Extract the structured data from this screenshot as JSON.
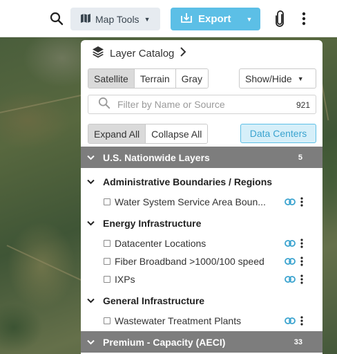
{
  "toolbar": {
    "map_tools_label": "Map Tools",
    "export_label": "Export"
  },
  "catalog": {
    "title": "Layer Catalog",
    "basemaps": [
      {
        "label": "Satellite",
        "active": true
      },
      {
        "label": "Terrain",
        "active": false
      },
      {
        "label": "Gray",
        "active": false
      }
    ],
    "show_hide_label": "Show/Hide",
    "filter_placeholder": "Filter by Name or Source",
    "filter_count": "921",
    "expand_all_label": "Expand All",
    "collapse_all_label": "Collapse All",
    "data_centers_label": "Data Centers"
  },
  "groups": [
    {
      "name": "U.S. Nationwide Layers",
      "count": "5",
      "subgroups": [
        {
          "name": "Administrative Boundaries / Regions",
          "layers": [
            "Water System Service Area Boun..."
          ]
        },
        {
          "name": "Energy Infrastructure",
          "layers": [
            "Datacenter Locations",
            "Fiber Broadband >1000/100 speed",
            "IXPs"
          ]
        },
        {
          "name": "General Infrastructure",
          "layers": [
            "Wastewater Treatment Plants"
          ]
        }
      ]
    },
    {
      "name": "Premium - Capacity (AECI)",
      "count": "33"
    }
  ],
  "colors": {
    "accent": "#5cbfe6",
    "group_header_bg": "#7d7d7d",
    "secondary_button_bg": "#e6ebf0"
  }
}
